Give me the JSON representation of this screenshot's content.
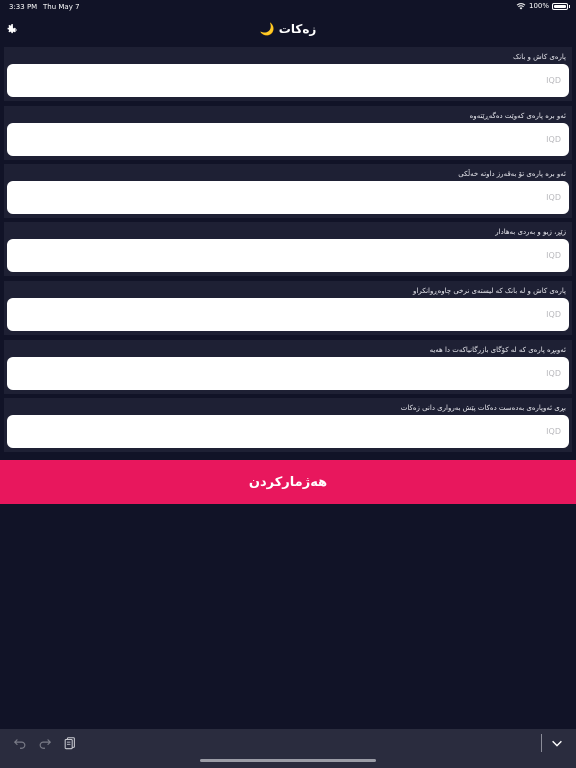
{
  "status": {
    "time": "3:33 PM",
    "date": "Thu May 7",
    "battery": "100%"
  },
  "header": {
    "title": "🌙 زەکات"
  },
  "fields": [
    {
      "label": "پارەی کاش و بانک",
      "placeholder": "IQD"
    },
    {
      "label": "ئەو برە پارەی کەوێت دەگەڕێتەوە",
      "placeholder": "IQD"
    },
    {
      "label": "ئەو برە پارەی تۆ بەقەرز داوتە خەڵکی",
      "placeholder": "IQD"
    },
    {
      "label": "زێڕ، زیو و بەردی بەهادار",
      "placeholder": "IQD"
    },
    {
      "label": "پارەی کاش و لە بانک کە لیستەی نرخی چاوەڕوانکراو",
      "placeholder": "IQD"
    },
    {
      "label": "ئەوبڕە پارەی کە لە کۆگای بازرگانیاکەت دا هەیە",
      "placeholder": "IQD"
    },
    {
      "label": "بڕی ئەوپارەی بەدەست دەکات پێش بەرواری دانی زەکات",
      "placeholder": "IQD"
    }
  ],
  "actions": {
    "calculate_label": "هەژمارکردن"
  },
  "colors": {
    "background": "#111327",
    "section": "#1e2034",
    "accent": "#e8175d",
    "toolbar": "#2a2c3e"
  },
  "icons": {
    "settings": "gear-icon",
    "undo": "undo-icon",
    "redo": "redo-icon",
    "paste": "clipboard-icon",
    "dismiss": "chevron-down-icon"
  }
}
